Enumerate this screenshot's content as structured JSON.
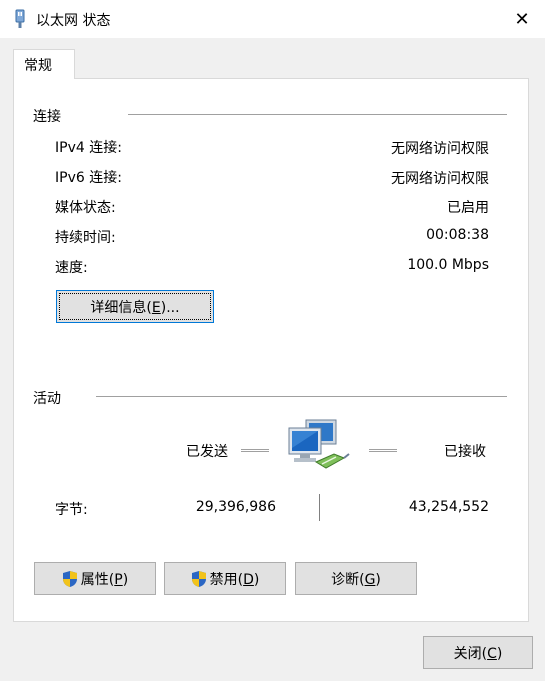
{
  "window": {
    "title": "以太网 状态",
    "close_glyph": "✕"
  },
  "tabs": [
    {
      "label": "常规"
    }
  ],
  "connection": {
    "group_label": "连接",
    "rows": [
      {
        "label": "IPv4 连接:",
        "value": "无网络访问权限"
      },
      {
        "label": "IPv6 连接:",
        "value": "无网络访问权限"
      },
      {
        "label": "媒体状态:",
        "value": "已启用"
      },
      {
        "label": "持续时间:",
        "value": "00:08:38"
      },
      {
        "label": "速度:",
        "value": "100.0 Mbps"
      }
    ],
    "details_button": {
      "label_pre": "详细信息(",
      "mnemonic": "E",
      "label_post": ")..."
    }
  },
  "activity": {
    "group_label": "活动",
    "sent_label": "已发送",
    "received_label": "已接收",
    "bytes_label": "字节:",
    "bytes_sent": "29,396,986",
    "bytes_received": "43,254,552",
    "icon": "network-computers-icon"
  },
  "buttons": {
    "properties": {
      "label_pre": "属性(",
      "mnemonic": "P",
      "label_post": ")",
      "icon": "uac-shield-icon"
    },
    "disable": {
      "label_pre": "禁用(",
      "mnemonic": "D",
      "label_post": ")",
      "icon": "uac-shield-icon"
    },
    "diagnose": {
      "label_pre": "诊断(",
      "mnemonic": "G",
      "label_post": ")"
    },
    "close": {
      "label_pre": "关闭(",
      "mnemonic": "C",
      "label_post": ")"
    }
  },
  "colors": {
    "accent": "#0078d7",
    "panel_bg": "#ffffff",
    "window_bg": "#f0f0f0",
    "button_bg": "#e1e1e1"
  }
}
